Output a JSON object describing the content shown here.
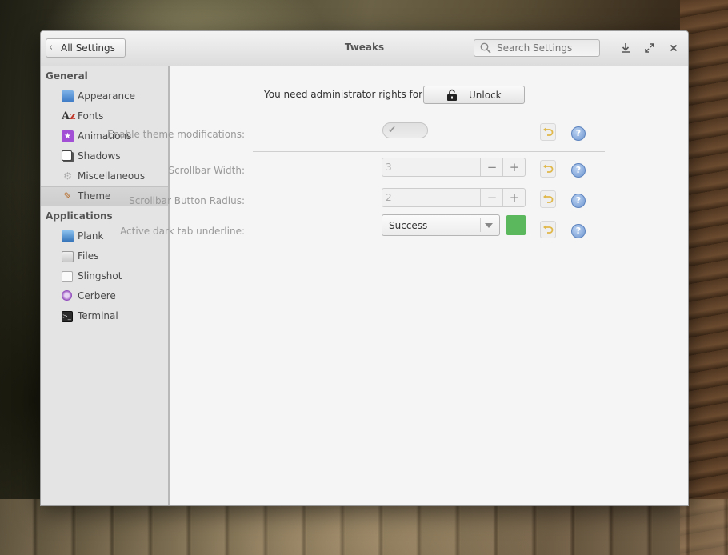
{
  "window": {
    "title": "Tweaks",
    "back_label": "All Settings",
    "search_placeholder": "Search Settings"
  },
  "sidebar": {
    "categories": [
      {
        "label": "General"
      },
      {
        "label": "Applications"
      }
    ],
    "general_items": [
      {
        "label": "Appearance",
        "icon": "appearance-icon"
      },
      {
        "label": "Fonts",
        "icon": "fonts-icon"
      },
      {
        "label": "Animations",
        "icon": "animations-icon"
      },
      {
        "label": "Shadows",
        "icon": "shadows-icon"
      },
      {
        "label": "Miscellaneous",
        "icon": "miscellaneous-icon"
      },
      {
        "label": "Theme",
        "icon": "theme-icon",
        "selected": true
      }
    ],
    "application_items": [
      {
        "label": "Plank",
        "icon": "plank-icon"
      },
      {
        "label": "Files",
        "icon": "files-icon"
      },
      {
        "label": "Slingshot",
        "icon": "slingshot-icon"
      },
      {
        "label": "Cerbere",
        "icon": "cerbere-icon"
      },
      {
        "label": "Terminal",
        "icon": "terminal-icon"
      }
    ]
  },
  "content": {
    "admin_text": "You need administrator rights for this",
    "unlock_label": "Unlock",
    "enable_theme": {
      "label": "Enable theme modifications:",
      "checked": true
    },
    "scrollbar_width": {
      "label": "Scrollbar Width:",
      "value": "3"
    },
    "scrollbar_radius": {
      "label": "Scrollbar Button Radius:",
      "value": "2"
    },
    "dark_tab": {
      "label": "Active dark tab underline:",
      "value": "Success",
      "color": "#5cb85c"
    },
    "minus_glyph": "−",
    "plus_glyph": "+",
    "help_glyph": "?"
  },
  "colors": {
    "accent_green": "#5cb85c",
    "help_blue": "#6e96d0"
  }
}
